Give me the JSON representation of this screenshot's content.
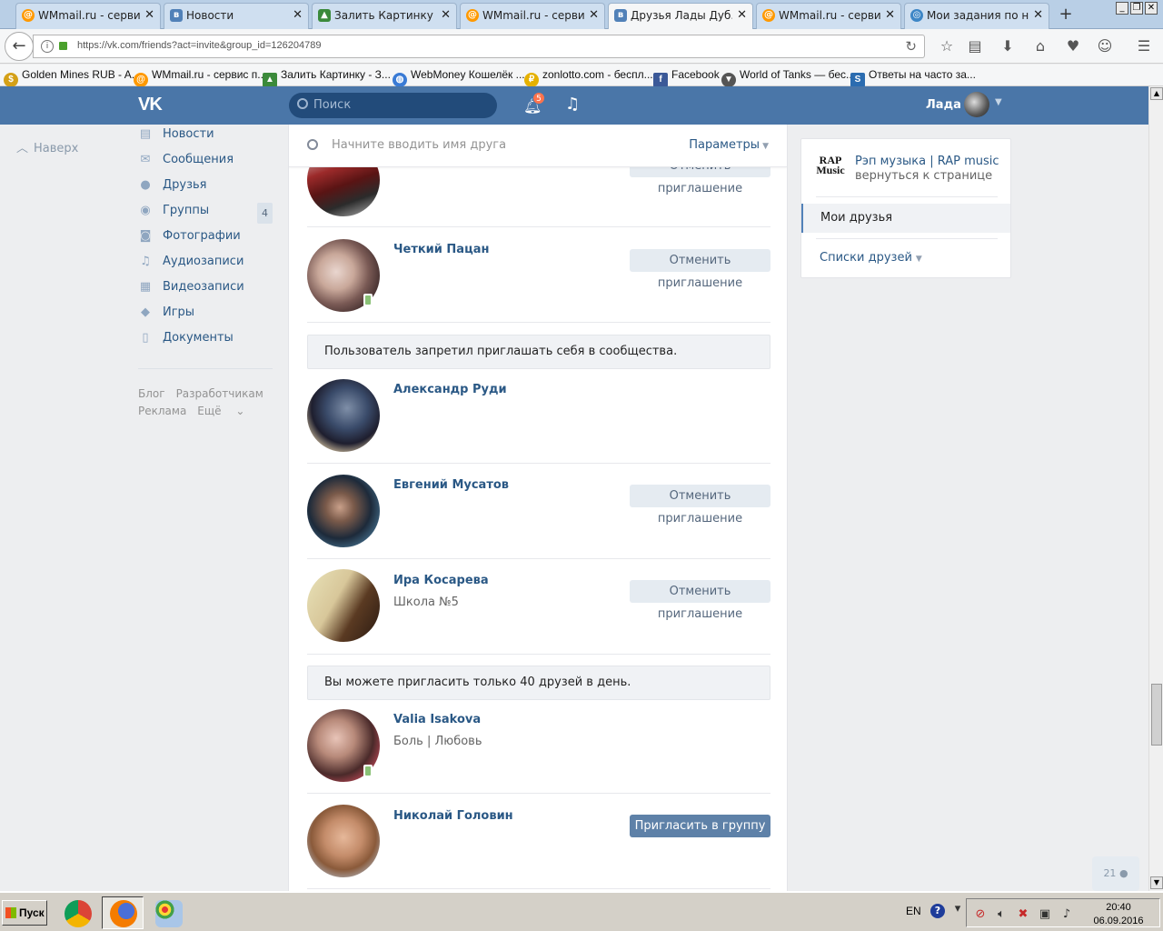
{
  "browser": {
    "tabs": [
      {
        "label": "WMmail.ru - сервис...",
        "icon": "wm"
      },
      {
        "label": "Новости",
        "icon": "vk"
      },
      {
        "label": "Залить Картинку - ...",
        "icon": "pic"
      },
      {
        "label": "WMmail.ru - сервис...",
        "icon": "wm"
      },
      {
        "label": "Друзья Лады Дуб...",
        "icon": "vk"
      },
      {
        "label": "WMmail.ru - сервис...",
        "icon": "wm"
      },
      {
        "label": "Мои задания по на...",
        "icon": "task"
      }
    ],
    "active_tab": 4,
    "new_tab": "+",
    "url": "https://vk.com/friends?act=invite&group_id=126204789",
    "bookmarks": [
      {
        "label": "Golden Mines RUB - A...",
        "color": "#d4a017"
      },
      {
        "label": "WMmail.ru - сервис п...",
        "color": "#ff9900"
      },
      {
        "label": "Залить Картинку - З...",
        "color": "#3b8a3b"
      },
      {
        "label": "WebMoney Кошелёк ...",
        "color": "#3a7bd5"
      },
      {
        "label": "zonlotto.com - беспл...",
        "color": "#e5b100"
      },
      {
        "label": "Facebook",
        "color": "#3b5998"
      },
      {
        "label": "World of Tanks — бес...",
        "color": "#555555"
      },
      {
        "label": "Ответы на часто за...",
        "color": "#2b6cb0"
      }
    ]
  },
  "vk": {
    "logo": "VK",
    "search_placeholder": "Поиск",
    "notif_count": "5",
    "user_name": "Лада",
    "back_to_top": "Наверх",
    "menu": [
      {
        "label": "Новости",
        "icon": "news-icon",
        "glyph": "▤"
      },
      {
        "label": "Сообщения",
        "icon": "messages-icon",
        "glyph": "✉"
      },
      {
        "label": "Друзья",
        "icon": "friends-icon",
        "glyph": "●"
      },
      {
        "label": "Группы",
        "icon": "groups-icon",
        "glyph": "◉",
        "count": "4"
      },
      {
        "label": "Фотографии",
        "icon": "photos-icon",
        "glyph": "◙"
      },
      {
        "label": "Аудиозаписи",
        "icon": "audio-icon",
        "glyph": "♫"
      },
      {
        "label": "Видеозаписи",
        "icon": "video-icon",
        "glyph": "▦"
      },
      {
        "label": "Игры",
        "icon": "games-icon",
        "glyph": "◆"
      },
      {
        "label": "Документы",
        "icon": "documents-icon",
        "glyph": "▯"
      }
    ],
    "footer_links": [
      "Блог",
      "Разработчикам",
      "Реклама",
      "Ещё"
    ],
    "friend_search_placeholder": "Начните вводить имя друга",
    "params_label": "Параметры",
    "cancel_label": "Отменить приглашение",
    "invite_label": "Пригласить в группу",
    "notice_forbidden": "Пользователь запретил приглашать себя в сообщества.",
    "notice_limit": "Вы можете пригласить только 40 друзей в день.",
    "friends": [
      {
        "name": "Четкий Пацан",
        "sub": "",
        "action": "cancel",
        "mobile": true
      },
      {
        "name": "Александр Руди",
        "sub": "",
        "action": "none",
        "mobile": false
      },
      {
        "name": "Евгений Мусатов",
        "sub": "",
        "action": "cancel",
        "mobile": false
      },
      {
        "name": "Ира Косарева",
        "sub": "Школа №5",
        "action": "cancel",
        "mobile": false
      },
      {
        "name": "Valia Isakova",
        "sub": "Боль | Любовь",
        "action": "none",
        "mobile": true
      },
      {
        "name": "Николай Головин",
        "sub": "",
        "action": "invite",
        "mobile": false
      }
    ],
    "right": {
      "group_name": "Рэп музыка | RAP music",
      "back_link": "вернуться к странице",
      "group_logo_text": "RAP Music",
      "my_friends": "Мои друзья",
      "friend_lists": "Списки друзей"
    },
    "chat_count": "21"
  },
  "taskbar": {
    "start_label": "Пуск",
    "lang": "EN",
    "time": "20:40",
    "date": "06.09.2016"
  }
}
